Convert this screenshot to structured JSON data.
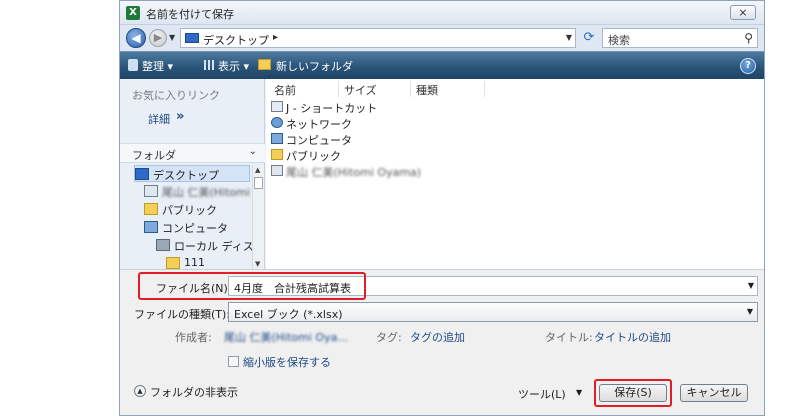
{
  "window": {
    "title": "名前を付けて保存",
    "app_icon_label": "X",
    "close_label": "⨯"
  },
  "address_bar": {
    "path": "デスクトップ",
    "path_separator": "▸",
    "search_placeholder": "検索"
  },
  "toolbar": {
    "organize_label": "整理 ▾",
    "views_label": "表示 ▾",
    "new_folder_label": "新しいフォルダ",
    "help_label": "?"
  },
  "nav_pane": {
    "favorites_header": "お気に入りリンク",
    "details_label": "詳細",
    "details_chevron": "»",
    "folders_label": "フォルダ",
    "tree": [
      {
        "label": "デスクトップ",
        "icon": "desktop-icon",
        "blurred": false,
        "selected": true
      },
      {
        "label": "尾山 仁美(Hitomi",
        "icon": "user-icon",
        "blurred": true,
        "selected": false
      },
      {
        "label": "パブリック",
        "icon": "folder-icon",
        "blurred": false,
        "selected": false
      },
      {
        "label": "コンピュータ",
        "icon": "computer-icon",
        "blurred": false,
        "selected": false
      },
      {
        "label": "ローカル ディス",
        "icon": "drive-icon",
        "blurred": false,
        "selected": false
      },
      {
        "label": "111",
        "icon": "folder-icon",
        "blurred": false,
        "selected": false
      }
    ]
  },
  "file_list": {
    "columns": [
      "名前",
      "サイズ",
      "種類"
    ],
    "items": [
      {
        "label": "J - ショートカット",
        "icon": "shortcut-icon",
        "blurred": false
      },
      {
        "label": "ネットワーク",
        "icon": "network-icon",
        "blurred": false
      },
      {
        "label": "コンピュータ",
        "icon": "computer-icon",
        "blurred": false
      },
      {
        "label": "パブリック",
        "icon": "folder-icon",
        "blurred": false
      },
      {
        "label": "尾山 仁美(Hitomi Oyama)",
        "icon": "user-icon",
        "blurred": true
      }
    ]
  },
  "form": {
    "filename_label": "ファイル名(N):",
    "filename_value": "4月度　合計残高試算表",
    "filetype_label": "ファイルの種類(T):",
    "filetype_value": "Excel ブック (*.xlsx)",
    "author_label": "作成者:",
    "author_value": "尾山 仁美(Hitomi Oya...",
    "tags_label": "タグ:",
    "tags_value": "タグの追加",
    "title_label": "タイトル:",
    "title_value": "タイトルの追加",
    "thumbnail_label": "縮小版を保存する"
  },
  "footer": {
    "hide_folders_label": "フォルダの非表示",
    "tools_label": "ツール(L)",
    "save_label": "保存(S)",
    "cancel_label": "キャンセル"
  },
  "colors": {
    "highlight_frame": "#e01e2a",
    "toolbar_bg": "#2a5478",
    "link": "#1f4a86"
  }
}
